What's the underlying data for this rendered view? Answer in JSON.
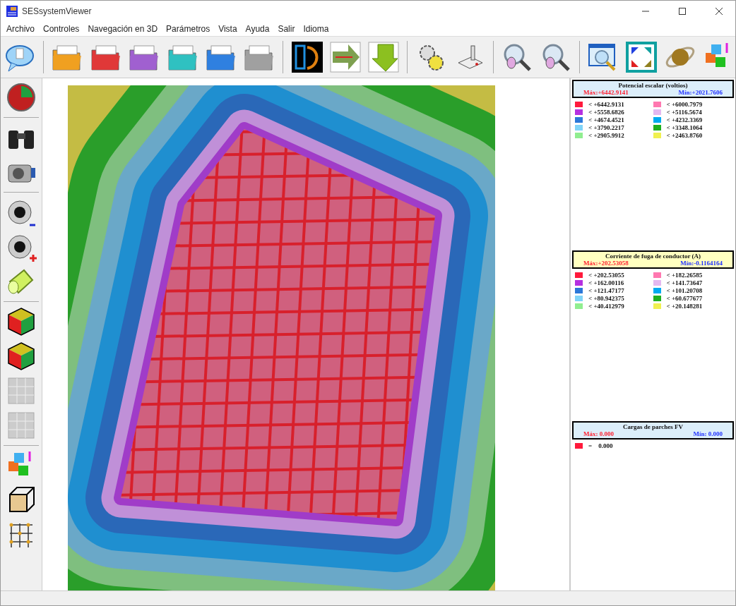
{
  "window": {
    "title": "SESsystemViewer"
  },
  "menu": [
    "Archivo",
    "Controles",
    "Navegación en 3D",
    "Parámetros",
    "Vista",
    "Ayuda",
    "Salir",
    "Idioma"
  ],
  "legends": [
    {
      "title": "Potencial escalar (voltios)",
      "max": "Máx:+6442.9141",
      "min": "Mín:+2021.7606",
      "color": "#dceefa",
      "entries": [
        {
          "color": "#ff1a3c",
          "label": "< +6442.9131"
        },
        {
          "color": "#ff78b0",
          "label": "< +6000.7979"
        },
        {
          "color": "#b530e0",
          "label": "< +5558.6826"
        },
        {
          "color": "#e4b8f0",
          "label": "< +5116.5674"
        },
        {
          "color": "#2b78d8",
          "label": "< +4674.4521"
        },
        {
          "color": "#00aaf0",
          "label": "< +4232.3369"
        },
        {
          "color": "#80d4f8",
          "label": "< +3790.2217"
        },
        {
          "color": "#20b020",
          "label": "< +3348.1064"
        },
        {
          "color": "#90ee90",
          "label": "< +2905.9912"
        },
        {
          "color": "#f0f050",
          "label": "< +2463.8760"
        }
      ]
    },
    {
      "title": "Corriente de fuga de conductor (A)",
      "max": "Máx:+202.53058",
      "min": "Mín:-0.1164164",
      "color": "#ffffc0",
      "entries": [
        {
          "color": "#ff1a3c",
          "label": "< +202.53055"
        },
        {
          "color": "#ff78b0",
          "label": "< +182.26585"
        },
        {
          "color": "#b530e0",
          "label": "< +162.00116"
        },
        {
          "color": "#e4b8f0",
          "label": "< +141.73647"
        },
        {
          "color": "#2b78d8",
          "label": "< +121.47177"
        },
        {
          "color": "#00aaf0",
          "label": "< +101.20708"
        },
        {
          "color": "#80d4f8",
          "label": "< +80.942375"
        },
        {
          "color": "#20b020",
          "label": "< +60.677677"
        },
        {
          "color": "#90ee90",
          "label": "< +40.412979"
        },
        {
          "color": "#f0f050",
          "label": "< +20.148281"
        }
      ]
    },
    {
      "title": "Cargas de parches FV",
      "max": "Máx:  0.000",
      "min": "Mín:  0.000",
      "color": "#dceefa",
      "entries": [
        {
          "color": "#ff1a3c",
          "label": "=    0.000"
        }
      ]
    }
  ]
}
